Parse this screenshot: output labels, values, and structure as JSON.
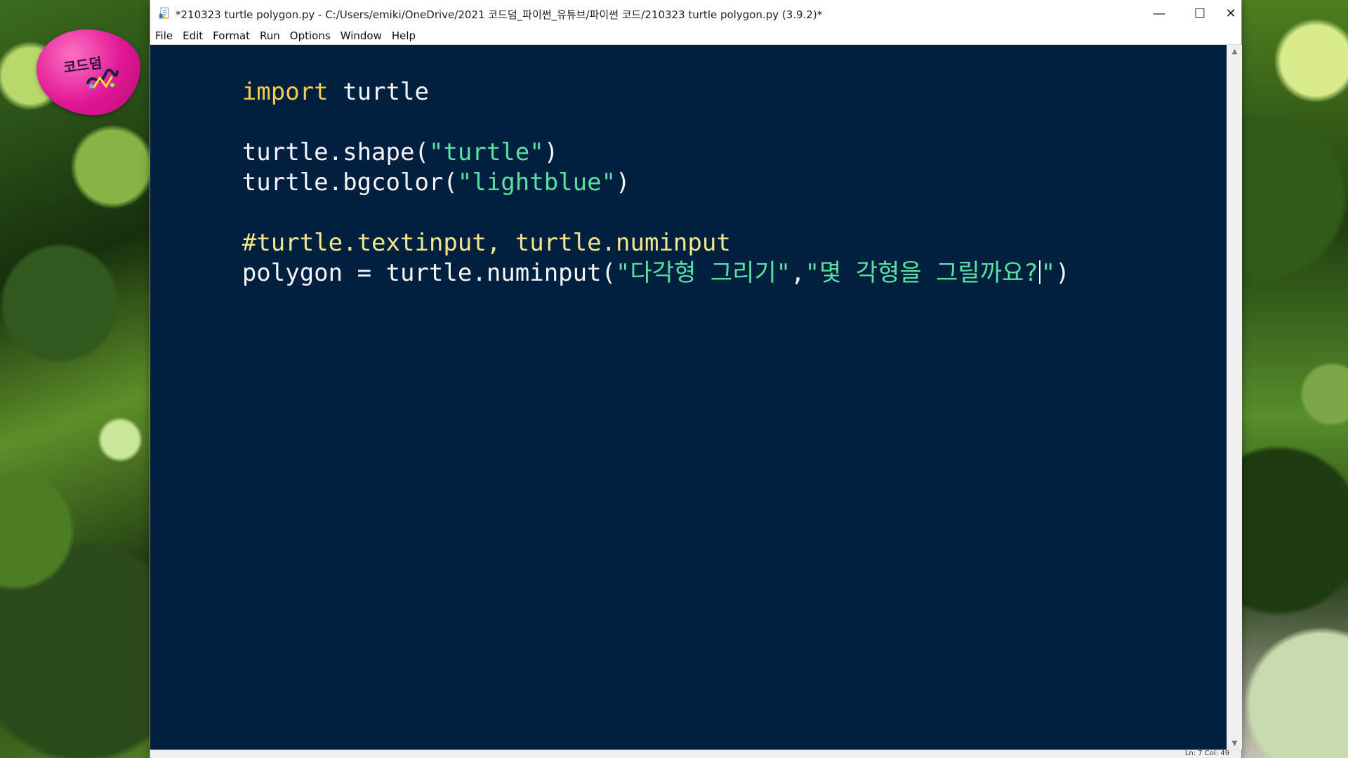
{
  "window": {
    "title": "*210323 turtle polygon.py - C:/Users/emiki/OneDrive/2021 코드덤_파이썬_유튜브/파이썬 코드/210323 turtle polygon.py (3.9.2)*",
    "minimize_icon": "minimize-icon",
    "maximize_icon": "maximize-icon",
    "close_icon": "close-icon"
  },
  "menu": {
    "items": [
      "File",
      "Edit",
      "Format",
      "Run",
      "Options",
      "Window",
      "Help"
    ]
  },
  "code": {
    "line1": {
      "keyword": "import",
      "rest": " turtle"
    },
    "line3": {
      "plain": "turtle.shape(",
      "string": "\"turtle\"",
      "end": ")"
    },
    "line4": {
      "plain": "turtle.bgcolor(",
      "string": "\"lightblue\"",
      "end": ")"
    },
    "line6": {
      "comment": "#turtle.textinput, turtle.numinput"
    },
    "line7": {
      "plain": "polygon = turtle.numinput(",
      "string1": "\"다각형 그리기\"",
      "comma": ",",
      "string2_before_cursor": "\"몇 각형을 그릴까요?",
      "string2_after_cursor": "\"",
      "end": ")"
    }
  },
  "statusbar": {
    "text": "Ln: 7  Col: 49"
  },
  "background": {
    "logo_text": "코드덤"
  },
  "colors": {
    "editor_background": "#011f3f",
    "keyword": "#f2cf45",
    "string": "#59e1a2",
    "comment": "#f2e68a",
    "text": "#f5f5f5",
    "logo_pink": "#e01693"
  },
  "icons": {
    "app": "python-file-icon",
    "scroll_up": "arrow-up-icon",
    "scroll_down": "arrow-down-icon",
    "text_cursor": "i-beam-cursor-icon"
  }
}
